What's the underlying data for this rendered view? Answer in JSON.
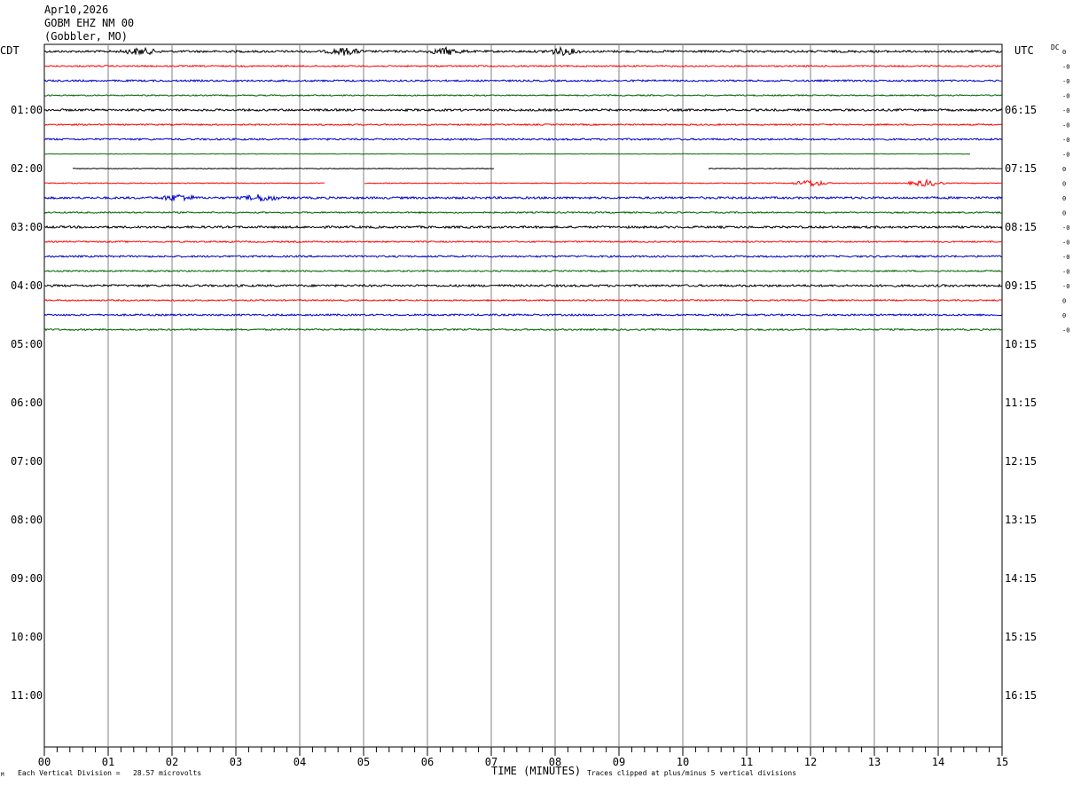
{
  "header": {
    "date": "Apr10,2026",
    "station": "GOBM EHZ NM 00",
    "location": "(Gobbler, MO)"
  },
  "left_tz": "CDT",
  "right_tz": "UTC",
  "dc_label": "DC",
  "footer": {
    "scale": "Each Vertical Division =   28.57 microvolts",
    "xlabel": "TIME (MINUTES)",
    "clip": "Traces clipped at plus/minus 5 vertical divisions",
    "corner": "M"
  },
  "chart_data": {
    "type": "line",
    "title": "GOBM EHZ NM 00",
    "xlabel": "TIME (MINUTES)",
    "ylabel": "",
    "xlim": [
      0,
      15
    ],
    "x_ticks": [
      "00",
      "01",
      "02",
      "03",
      "04",
      "05",
      "06",
      "07",
      "08",
      "09",
      "10",
      "11",
      "12",
      "13",
      "14",
      "15"
    ],
    "left_hour_labels": [
      "01:00",
      "02:00",
      "03:00",
      "04:00",
      "05:00",
      "06:00",
      "07:00",
      "08:00",
      "09:00",
      "10:00",
      "11:00"
    ],
    "right_hour_labels": [
      "06:15",
      "07:15",
      "08:15",
      "09:15",
      "10:15",
      "11:15",
      "12:15",
      "13:15",
      "14:15",
      "15:15",
      "16:15"
    ],
    "trace_colors": [
      "#000000",
      "#ff0000",
      "#0000cc",
      "#006600"
    ],
    "dc_offsets": [
      "0",
      "-0",
      "-0",
      "-0",
      "-0",
      "-0",
      "-0",
      "-0",
      "0",
      "0",
      "0",
      "0",
      "-0",
      "-0",
      "-0",
      "-0",
      "-0",
      "0",
      "0",
      "-0"
    ],
    "grid": true,
    "traces": [
      {
        "row": 0,
        "start_min": 0,
        "end_min": 15,
        "gaps": [],
        "noise": 1.2,
        "bursts": [
          1.5,
          4.7,
          6.3,
          8.1
        ]
      },
      {
        "row": 1,
        "start_min": 0,
        "end_min": 15,
        "gaps": [],
        "noise": 0.8,
        "bursts": []
      },
      {
        "row": 2,
        "start_min": 0,
        "end_min": 15,
        "gaps": [],
        "noise": 1.0,
        "bursts": []
      },
      {
        "row": 3,
        "start_min": 0,
        "end_min": 15,
        "gaps": [],
        "noise": 0.7,
        "bursts": []
      },
      {
        "row": 4,
        "start_min": 0,
        "end_min": 15,
        "gaps": [],
        "noise": 1.2,
        "bursts": []
      },
      {
        "row": 5,
        "start_min": 0,
        "end_min": 15,
        "gaps": [],
        "noise": 0.8,
        "bursts": []
      },
      {
        "row": 6,
        "start_min": 0,
        "end_min": 15,
        "gaps": [],
        "noise": 1.0,
        "bursts": []
      },
      {
        "row": 7,
        "start_min": 0,
        "end_min": 14.5,
        "gaps": [],
        "noise": 0.3,
        "bursts": []
      },
      {
        "row": 8,
        "start_min": 0.45,
        "end_min": 15,
        "gaps": [
          [
            7.05,
            10.4
          ]
        ],
        "noise": 0.4,
        "bursts": []
      },
      {
        "row": 9,
        "start_min": 0,
        "end_min": 15,
        "gaps": [
          [
            4.4,
            5.0
          ]
        ],
        "noise": 0.5,
        "bursts": [
          12.0,
          13.8
        ]
      },
      {
        "row": 10,
        "start_min": 0,
        "end_min": 15,
        "gaps": [],
        "noise": 1.2,
        "bursts": [
          2.1,
          3.4
        ]
      },
      {
        "row": 11,
        "start_min": 0,
        "end_min": 15,
        "gaps": [],
        "noise": 0.8,
        "bursts": []
      },
      {
        "row": 12,
        "start_min": 0,
        "end_min": 15,
        "gaps": [],
        "noise": 1.2,
        "bursts": []
      },
      {
        "row": 13,
        "start_min": 0,
        "end_min": 15,
        "gaps": [],
        "noise": 0.8,
        "bursts": []
      },
      {
        "row": 14,
        "start_min": 0,
        "end_min": 15,
        "gaps": [],
        "noise": 1.0,
        "bursts": []
      },
      {
        "row": 15,
        "start_min": 0,
        "end_min": 15,
        "gaps": [],
        "noise": 0.8,
        "bursts": []
      },
      {
        "row": 16,
        "start_min": 0,
        "end_min": 15,
        "gaps": [],
        "noise": 1.2,
        "bursts": []
      },
      {
        "row": 17,
        "start_min": 0,
        "end_min": 15,
        "gaps": [],
        "noise": 0.8,
        "bursts": []
      },
      {
        "row": 18,
        "start_min": 0,
        "end_min": 15,
        "gaps": [],
        "noise": 1.0,
        "bursts": []
      },
      {
        "row": 19,
        "start_min": 0,
        "end_min": 15,
        "gaps": [],
        "noise": 0.9,
        "bursts": []
      }
    ]
  }
}
